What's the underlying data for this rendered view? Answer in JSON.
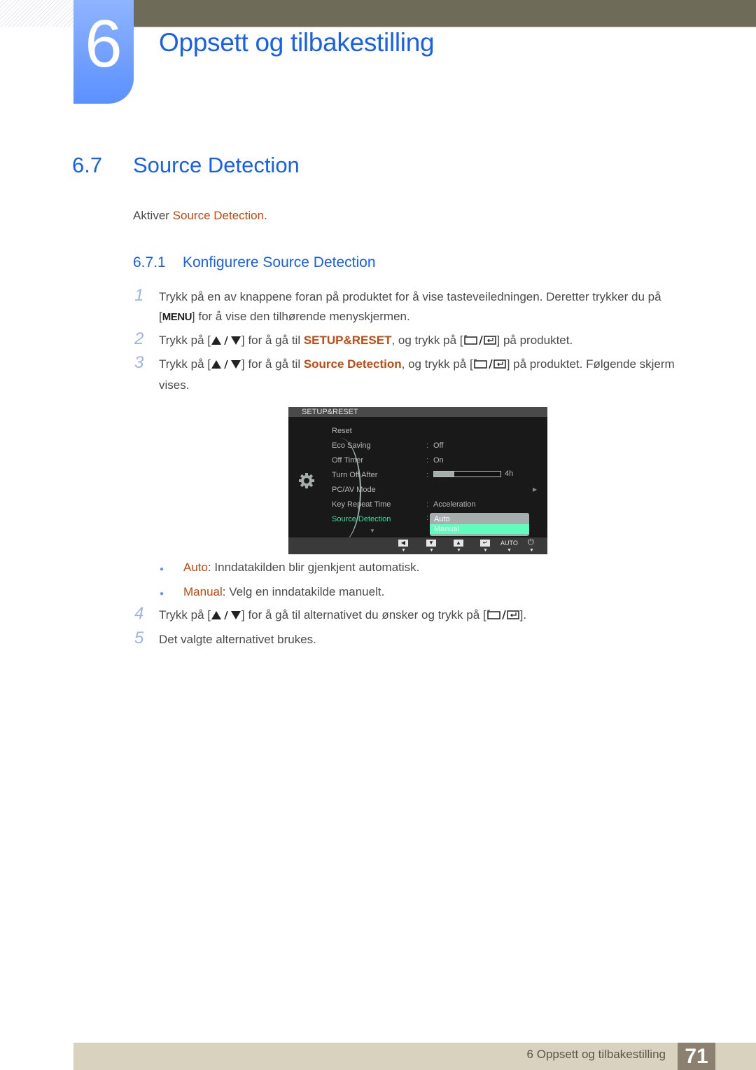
{
  "header": {
    "chapter_number": "6",
    "chapter_title": "Oppsett og tilbakestilling"
  },
  "section": {
    "number": "6.7",
    "title": "Source Detection",
    "intro_prefix": "Aktiver ",
    "intro_highlight": "Source Detection",
    "intro_suffix": "."
  },
  "subsection": {
    "number": "6.7.1",
    "title": "Konfigurere Source Detection"
  },
  "steps": [
    {
      "num": "1",
      "line1": "Trykk på en av knappene foran på produktet for å vise tasteveiledningen. Deretter trykker du på",
      "menu_key": "MENU",
      "line2": "] for å vise den tilhørende menyskjermen."
    },
    {
      "num": "2",
      "prefix": "Trykk på [",
      "mid": "] for å gå til ",
      "highlight": "SETUP&RESET",
      "mid2": ", og trykk på [",
      "suffix": "] på produktet."
    },
    {
      "num": "3",
      "prefix": "Trykk på [",
      "mid": "] for å gå til ",
      "highlight": "Source Detection",
      "mid2": ", og trykk på [",
      "suffix": "] på produktet. Følgende skjerm",
      "line2": "vises."
    },
    {
      "num": "4",
      "prefix": "Trykk på [",
      "mid": "] for å gå til alternativet du ønsker og trykk på [",
      "suffix": "]."
    },
    {
      "num": "5",
      "text": "Det valgte alternativet brukes."
    }
  ],
  "osd": {
    "title": "SETUP&RESET",
    "items": [
      {
        "label": "Reset",
        "value": ""
      },
      {
        "label": "Eco Saving",
        "value": "Off"
      },
      {
        "label": "Off Timer",
        "value": "On"
      },
      {
        "label": "Turn Off After",
        "value": "4h",
        "progress": 0.3
      },
      {
        "label": "PC/AV Mode",
        "value": ""
      },
      {
        "label": "Key Repeat Time",
        "value": "Acceleration"
      },
      {
        "label": "Source Detection",
        "value": "",
        "active": true
      }
    ],
    "dropdown_options": [
      "Auto",
      "Manual"
    ],
    "dropdown_selected": "Manual",
    "footer_buttons": [
      "left",
      "down",
      "up",
      "enter",
      "AUTO",
      "power"
    ],
    "active_color": "#3fdca0",
    "selected_color": "#5effbd"
  },
  "options": [
    {
      "name": "Auto",
      "desc": ": Inndatakilden blir gjenkjent automatisk."
    },
    {
      "name": "Manual",
      "desc": ": Velg en inndatakilde manuelt."
    }
  ],
  "footer": {
    "chapter_label": "6 Oppsett og tilbakestilling",
    "page_number": "71"
  },
  "colors": {
    "heading_blue": "#1560f2",
    "highlight_orange": "#c5480e",
    "top_bar": "#6e6c59",
    "footer_bg": "#d9d2bf",
    "page_box": "#8c8071"
  }
}
